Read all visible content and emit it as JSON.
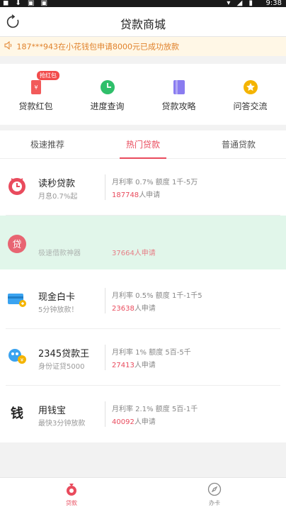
{
  "status_bar": {
    "time": "9:38"
  },
  "header": {
    "title": "贷款商城",
    "refresh_icon": "refresh-icon"
  },
  "notice": {
    "text": "187***943在小花钱包申请8000元已成功放款",
    "icon": "speaker-icon",
    "color": "#e0812a"
  },
  "quick_links": [
    {
      "label": "贷款红包",
      "icon": "red-envelope-icon",
      "badge": "抢红包",
      "color": "#f25a5a"
    },
    {
      "label": "进度查询",
      "icon": "clock-icon",
      "color": "#2fbf6a"
    },
    {
      "label": "贷款攻略",
      "icon": "book-icon",
      "color": "#8a7cf0"
    },
    {
      "label": "问答交流",
      "icon": "star-badge-icon",
      "color": "#f4b400"
    }
  ],
  "tabs": [
    {
      "label": "极速推荐",
      "active": false
    },
    {
      "label": "热门贷款",
      "active": true
    },
    {
      "label": "普通贷款",
      "active": false
    }
  ],
  "loans": [
    {
      "name": "读秒贷款",
      "sub": "月息0.7%起",
      "rate": "月利率 0.7% 额度 1千-5万",
      "applicants": "187748",
      "apply_suffix": "人申请",
      "icon": "dumiao-logo-icon"
    },
    {
      "name": "现金白卡",
      "sub": "5分钟放款！",
      "rate": "月利率 0.5% 额度 1千-1千5",
      "applicants": "23638",
      "apply_suffix": "人申请",
      "icon": "credit-card-icon"
    },
    {
      "name": "2345贷款王",
      "sub": "身份证贷5000",
      "rate": "月利率 1% 额度 5百-5千",
      "applicants": "27413",
      "apply_suffix": "人申请",
      "icon": "mascot-icon"
    },
    {
      "name": "用钱宝",
      "sub": "最快3分钟放款",
      "rate": "月利率 2.1% 额度 5百-1千",
      "applicants": "40092",
      "apply_suffix": "人申请",
      "icon": "yongqianbao-logo-icon"
    }
  ],
  "overlay_row": {
    "sub": "极速借款神器",
    "applicants_fragment": "37664人申请",
    "icon": "dai-logo-icon",
    "accent": "#e94b5d"
  },
  "bottom_nav": [
    {
      "label": "贷款",
      "icon": "money-bag-icon",
      "active": true
    },
    {
      "label": "办卡",
      "icon": "compass-icon",
      "active": false
    }
  ],
  "colors": {
    "accent": "#e94b5d",
    "background": "#f2f2f2"
  }
}
